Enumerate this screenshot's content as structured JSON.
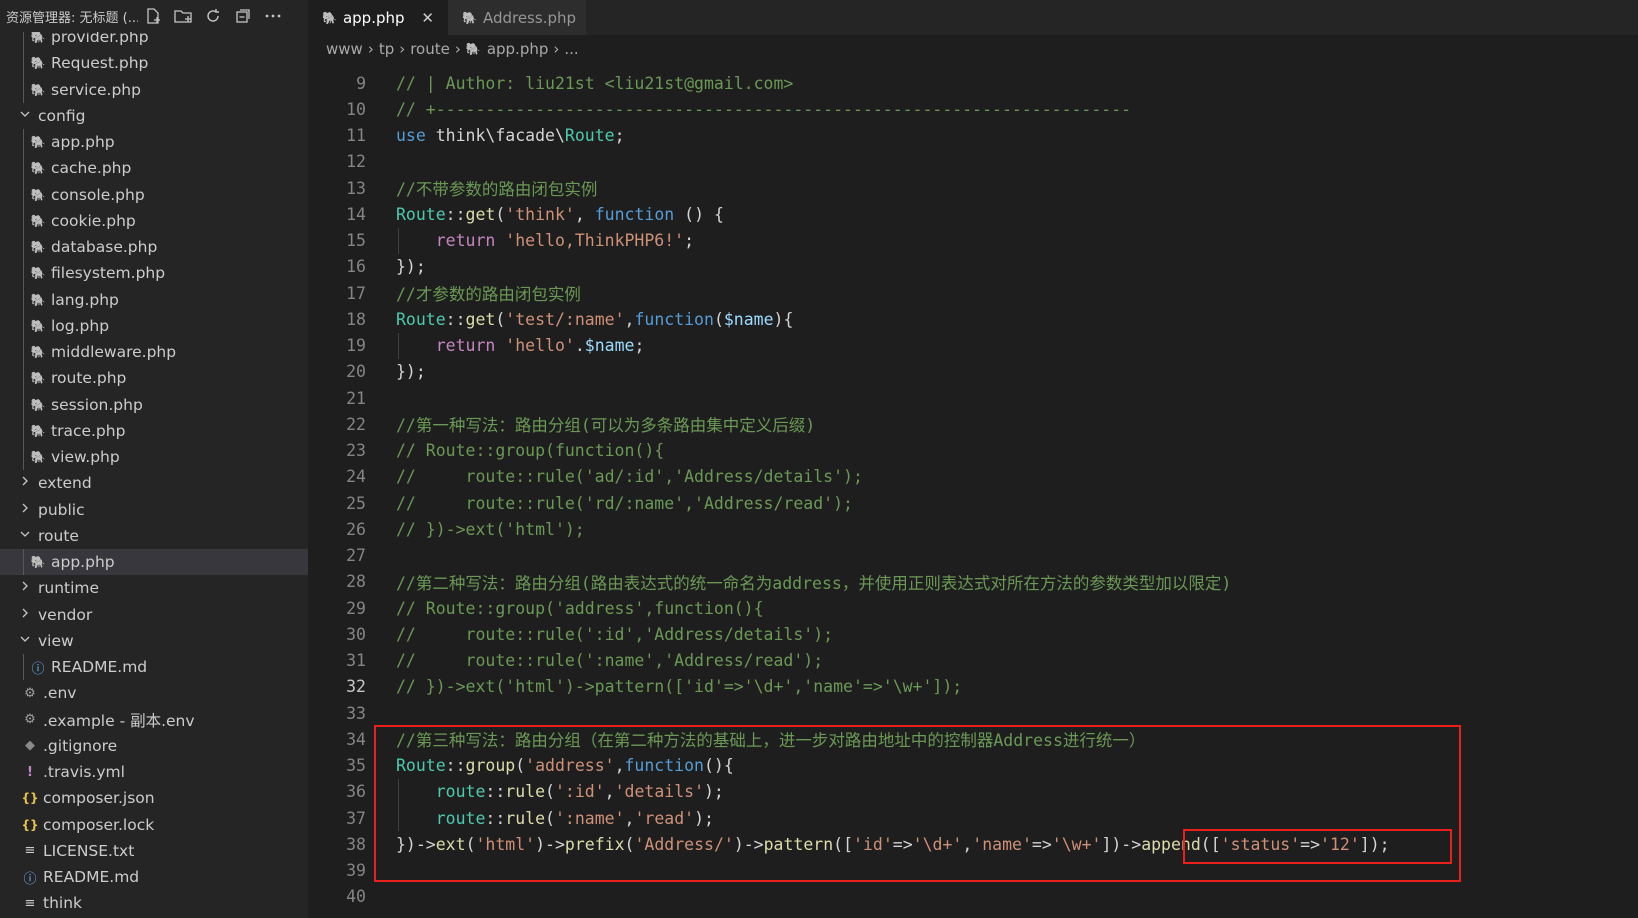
{
  "explorer": {
    "title": "资源管理器: 无标题 (...",
    "icons": [
      "new-file-icon",
      "new-folder-icon",
      "refresh-icon",
      "collapse-all-icon",
      "more-icon"
    ],
    "items": [
      {
        "label": "provider.php",
        "icon": "php",
        "depth": 1
      },
      {
        "label": "Request.php",
        "icon": "php",
        "depth": 1
      },
      {
        "label": "service.php",
        "icon": "php",
        "depth": 1
      },
      {
        "label": "config",
        "icon": "folder-open",
        "depth": 0
      },
      {
        "label": "app.php",
        "icon": "php",
        "depth": 1
      },
      {
        "label": "cache.php",
        "icon": "php",
        "depth": 1
      },
      {
        "label": "console.php",
        "icon": "php",
        "depth": 1
      },
      {
        "label": "cookie.php",
        "icon": "php",
        "depth": 1
      },
      {
        "label": "database.php",
        "icon": "php",
        "depth": 1
      },
      {
        "label": "filesystem.php",
        "icon": "php",
        "depth": 1
      },
      {
        "label": "lang.php",
        "icon": "php",
        "depth": 1
      },
      {
        "label": "log.php",
        "icon": "php",
        "depth": 1
      },
      {
        "label": "middleware.php",
        "icon": "php",
        "depth": 1
      },
      {
        "label": "route.php",
        "icon": "php",
        "depth": 1
      },
      {
        "label": "session.php",
        "icon": "php",
        "depth": 1
      },
      {
        "label": "trace.php",
        "icon": "php",
        "depth": 1
      },
      {
        "label": "view.php",
        "icon": "php",
        "depth": 1
      },
      {
        "label": "extend",
        "icon": "folder-closed",
        "depth": 0
      },
      {
        "label": "public",
        "icon": "folder-closed",
        "depth": 0
      },
      {
        "label": "route",
        "icon": "folder-open",
        "depth": 0
      },
      {
        "label": "app.php",
        "icon": "php",
        "depth": 1,
        "selected": true
      },
      {
        "label": "runtime",
        "icon": "folder-closed",
        "depth": 0
      },
      {
        "label": "vendor",
        "icon": "folder-closed",
        "depth": 0
      },
      {
        "label": "view",
        "icon": "folder-open",
        "depth": 0
      },
      {
        "label": "README.md",
        "icon": "info",
        "depth": 1
      },
      {
        "label": ".env",
        "icon": "gear",
        "depth": 0
      },
      {
        "label": ".example - 副本.env",
        "icon": "gear",
        "depth": 0
      },
      {
        "label": ".gitignore",
        "icon": "git",
        "depth": 0
      },
      {
        "label": ".travis.yml",
        "icon": "yml",
        "depth": 0
      },
      {
        "label": "composer.json",
        "icon": "json",
        "depth": 0
      },
      {
        "label": "composer.lock",
        "icon": "json",
        "depth": 0
      },
      {
        "label": "LICENSE.txt",
        "icon": "lines",
        "depth": 0
      },
      {
        "label": "README.md",
        "icon": "info",
        "depth": 0
      },
      {
        "label": "think",
        "icon": "lines",
        "depth": 0
      }
    ]
  },
  "tabs": [
    {
      "label": "app.php",
      "active": true,
      "close": "✕"
    },
    {
      "label": "Address.php",
      "active": false
    }
  ],
  "breadcrumb": [
    "www",
    "tp",
    "route",
    "app.php",
    "..."
  ],
  "current_line": 32,
  "code": [
    {
      "n": 9,
      "t": [
        [
          "c",
          "// | Author: liu21st <liu21st@gmail.com>"
        ]
      ]
    },
    {
      "n": 10,
      "t": [
        [
          "c",
          "// +----------------------------------------------------------------------"
        ]
      ]
    },
    {
      "n": 11,
      "t": [
        [
          "k",
          "use"
        ],
        [
          "p",
          " think\\facade\\"
        ],
        [
          "t",
          "Route"
        ],
        [
          "p",
          ";"
        ]
      ]
    },
    {
      "n": 12,
      "t": []
    },
    {
      "n": 13,
      "t": [
        [
          "c",
          "//不带参数的路由闭包实例"
        ]
      ]
    },
    {
      "n": 14,
      "t": [
        [
          "t",
          "Route"
        ],
        [
          "p",
          "::"
        ],
        [
          "f",
          "get"
        ],
        [
          "p",
          "("
        ],
        [
          "s",
          "'think'"
        ],
        [
          "p",
          ", "
        ],
        [
          "k",
          "function"
        ],
        [
          "p",
          " () {"
        ]
      ]
    },
    {
      "n": 15,
      "g": true,
      "t": [
        [
          "p",
          "    "
        ],
        [
          "r",
          "return"
        ],
        [
          "p",
          " "
        ],
        [
          "s",
          "'hello,ThinkPHP6!'"
        ],
        [
          "p",
          ";"
        ]
      ]
    },
    {
      "n": 16,
      "t": [
        [
          "p",
          "});"
        ]
      ]
    },
    {
      "n": 17,
      "t": [
        [
          "c",
          "//才参数的路由闭包实例"
        ]
      ]
    },
    {
      "n": 18,
      "t": [
        [
          "t",
          "Route"
        ],
        [
          "p",
          "::"
        ],
        [
          "f",
          "get"
        ],
        [
          "p",
          "("
        ],
        [
          "s",
          "'test/:name'"
        ],
        [
          "p",
          ","
        ],
        [
          "k",
          "function"
        ],
        [
          "p",
          "("
        ],
        [
          "v",
          "$name"
        ],
        [
          "p",
          "){"
        ]
      ]
    },
    {
      "n": 19,
      "g": true,
      "t": [
        [
          "p",
          "    "
        ],
        [
          "r",
          "return"
        ],
        [
          "p",
          " "
        ],
        [
          "s",
          "'hello'"
        ],
        [
          "p",
          "."
        ],
        [
          "v",
          "$name"
        ],
        [
          "p",
          ";"
        ]
      ]
    },
    {
      "n": 20,
      "t": [
        [
          "p",
          "});"
        ]
      ]
    },
    {
      "n": 21,
      "t": []
    },
    {
      "n": 22,
      "t": [
        [
          "c",
          "//第一种写法：路由分组(可以为多条路由集中定义后缀)"
        ]
      ]
    },
    {
      "n": 23,
      "t": [
        [
          "c",
          "// Route::group(function(){"
        ]
      ]
    },
    {
      "n": 24,
      "t": [
        [
          "c",
          "//     route::rule('ad/:id','Address/details');"
        ]
      ]
    },
    {
      "n": 25,
      "t": [
        [
          "c",
          "//     route::rule('rd/:name','Address/read');"
        ]
      ]
    },
    {
      "n": 26,
      "t": [
        [
          "c",
          "// })->ext('html');"
        ]
      ]
    },
    {
      "n": 27,
      "t": []
    },
    {
      "n": 28,
      "t": [
        [
          "c",
          "//第二种写法：路由分组(路由表达式的统一命名为address，并使用正则表达式对所在方法的参数类型加以限定)"
        ]
      ]
    },
    {
      "n": 29,
      "t": [
        [
          "c",
          "// Route::group('address',function(){"
        ]
      ]
    },
    {
      "n": 30,
      "t": [
        [
          "c",
          "//     route::rule(':id','Address/details');"
        ]
      ]
    },
    {
      "n": 31,
      "t": [
        [
          "c",
          "//     route::rule(':name','Address/read');"
        ]
      ]
    },
    {
      "n": 32,
      "t": [
        [
          "c",
          "// })->ext('html')->pattern(['id'=>'\\d+','name'=>'\\w+']);"
        ]
      ]
    },
    {
      "n": 33,
      "t": []
    },
    {
      "n": 34,
      "t": [
        [
          "c",
          "//第三种写法：路由分组（在第二种方法的基础上，进一步对路由地址中的控制器Address进行统一）"
        ]
      ]
    },
    {
      "n": 35,
      "t": [
        [
          "t",
          "Route"
        ],
        [
          "p",
          "::"
        ],
        [
          "f",
          "group"
        ],
        [
          "p",
          "("
        ],
        [
          "s",
          "'address'"
        ],
        [
          "p",
          ","
        ],
        [
          "k",
          "function"
        ],
        [
          "p",
          "(){"
        ]
      ]
    },
    {
      "n": 36,
      "g": true,
      "t": [
        [
          "p",
          "    "
        ],
        [
          "t",
          "route"
        ],
        [
          "p",
          "::"
        ],
        [
          "f",
          "rule"
        ],
        [
          "p",
          "("
        ],
        [
          "s",
          "':id'"
        ],
        [
          "p",
          ","
        ],
        [
          "s",
          "'details'"
        ],
        [
          "p",
          ");"
        ]
      ]
    },
    {
      "n": 37,
      "g": true,
      "t": [
        [
          "p",
          "    "
        ],
        [
          "t",
          "route"
        ],
        [
          "p",
          "::"
        ],
        [
          "f",
          "rule"
        ],
        [
          "p",
          "("
        ],
        [
          "s",
          "':name'"
        ],
        [
          "p",
          ","
        ],
        [
          "s",
          "'read'"
        ],
        [
          "p",
          ");"
        ]
      ]
    },
    {
      "n": 38,
      "t": [
        [
          "p",
          "})->"
        ],
        [
          "f",
          "ext"
        ],
        [
          "p",
          "("
        ],
        [
          "s",
          "'html'"
        ],
        [
          "p",
          ")->"
        ],
        [
          "f",
          "prefix"
        ],
        [
          "p",
          "("
        ],
        [
          "s",
          "'Address/'"
        ],
        [
          "p",
          ")->"
        ],
        [
          "f",
          "pattern"
        ],
        [
          "p",
          "(["
        ],
        [
          "s",
          "'id'"
        ],
        [
          "p",
          "=>"
        ],
        [
          "s",
          "'\\d+'"
        ],
        [
          "p",
          ","
        ],
        [
          "s",
          "'name'"
        ],
        [
          "p",
          "=>"
        ],
        [
          "s",
          "'\\w+'"
        ],
        [
          "p",
          "])->"
        ],
        [
          "f",
          "append"
        ],
        [
          "p",
          "(["
        ],
        [
          "s",
          "'status'"
        ],
        [
          "p",
          "=>"
        ],
        [
          "s",
          "'12'"
        ],
        [
          "p",
          "]);"
        ]
      ]
    },
    {
      "n": 39,
      "t": []
    },
    {
      "n": 40,
      "t": []
    }
  ]
}
